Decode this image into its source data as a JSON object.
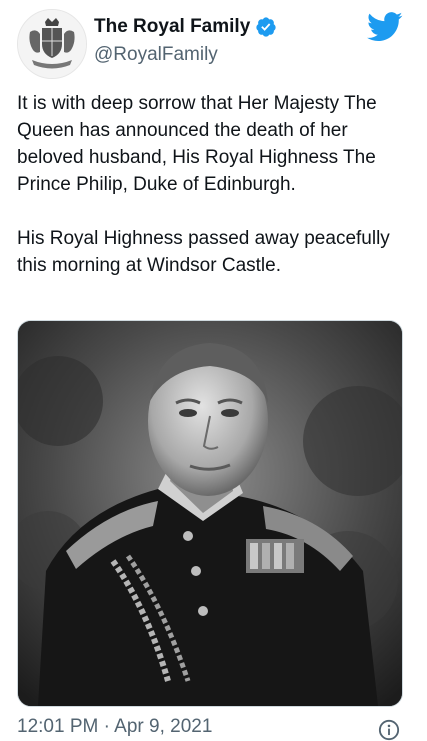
{
  "account": {
    "display_name": "The Royal Family",
    "handle": "@RoyalFamily",
    "verified": true,
    "avatar_icon": "royal-coat-of-arms"
  },
  "brand": {
    "icon": "twitter-bird-icon",
    "color": "#1d9bf0"
  },
  "tweet": {
    "paragraphs": [
      "It is with deep sorrow that Her Majesty The Queen has announced the death of her beloved husband, His Royal Highness The Prince Philip, Duke of Edinburgh.",
      "His Royal Highness passed away peacefully this morning at Windsor Castle."
    ],
    "media": {
      "type": "black-and-white portrait photograph"
    },
    "timestamp": "12:01 PM · Apr 9, 2021"
  },
  "colors": {
    "text": "#0f1419",
    "secondary_text": "#536471",
    "verified_badge": "#1d9bf0",
    "border": "#cfd9de"
  }
}
